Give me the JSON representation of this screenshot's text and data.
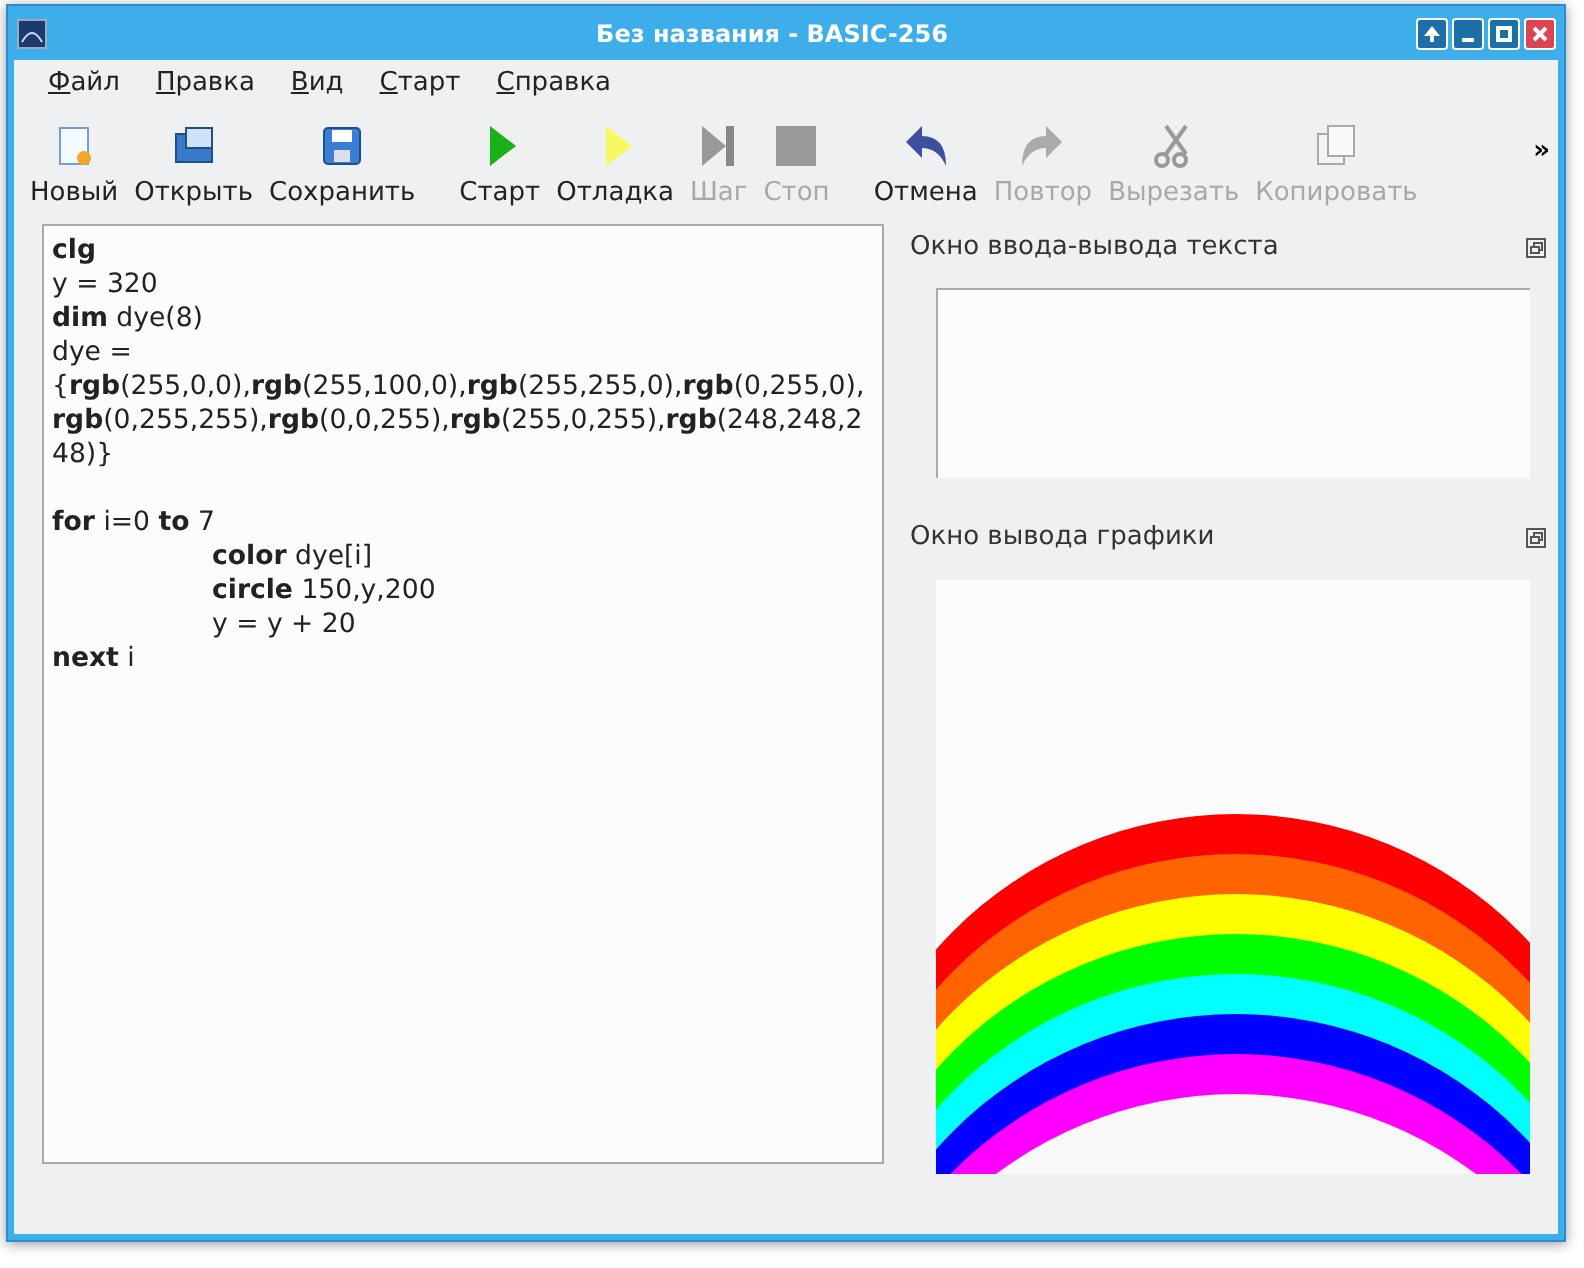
{
  "window": {
    "title": "Без названия - BASIC-256"
  },
  "menu": [
    {
      "label": "Файл"
    },
    {
      "label": "Правка"
    },
    {
      "label": "Вид"
    },
    {
      "label": "Старт"
    },
    {
      "label": "Справка"
    }
  ],
  "toolbar": [
    {
      "kind": "new",
      "label": "Новый",
      "disabled": false
    },
    {
      "kind": "open",
      "label": "Открыть",
      "disabled": false
    },
    {
      "kind": "save",
      "label": "Сохранить",
      "disabled": false
    },
    {
      "kind": "run",
      "label": "Старт",
      "disabled": false
    },
    {
      "kind": "debug",
      "label": "Отладка",
      "disabled": false
    },
    {
      "kind": "step",
      "label": "Шаг",
      "disabled": true
    },
    {
      "kind": "stop",
      "label": "Стоп",
      "disabled": true
    },
    {
      "kind": "undo",
      "label": "Отмена",
      "disabled": false
    },
    {
      "kind": "redo",
      "label": "Повтор",
      "disabled": true
    },
    {
      "kind": "cut",
      "label": "Вырезать",
      "disabled": true
    },
    {
      "kind": "copy",
      "label": "Копировать",
      "disabled": true
    }
  ],
  "toolbar_overflow": "»",
  "editor": {
    "blocks": [
      {
        "lines": [
          {
            "text": "**clg**"
          },
          {
            "text": "y = 320"
          },
          {
            "text": "**dim** dye(8)"
          },
          {
            "text": "dye ="
          },
          {
            "text": "{**rgb**(255,0,0),**rgb**(255,100,0),**rgb**(255,255,0),**rgb**(0,255,0),"
          },
          {
            "text": "**rgb**(0,255,255),**rgb**(0,0,255),**rgb**(255,0,255),**rgb**(248,248,2"
          },
          {
            "text": "48)}"
          }
        ]
      },
      {
        "lines": [
          {
            "text": "**for** i=0 **to** 7",
            "children": [
              {
                "text": "**color** dye[i]"
              },
              {
                "text": "**circle** 150,y,200"
              },
              {
                "text": "y = y + 20"
              }
            ]
          },
          {
            "text": "**next** i"
          }
        ]
      }
    ]
  },
  "text_output": {
    "title": "Окно ввода-вывода текста"
  },
  "graphics_output": {
    "title": "Окно вывода графики"
  }
}
